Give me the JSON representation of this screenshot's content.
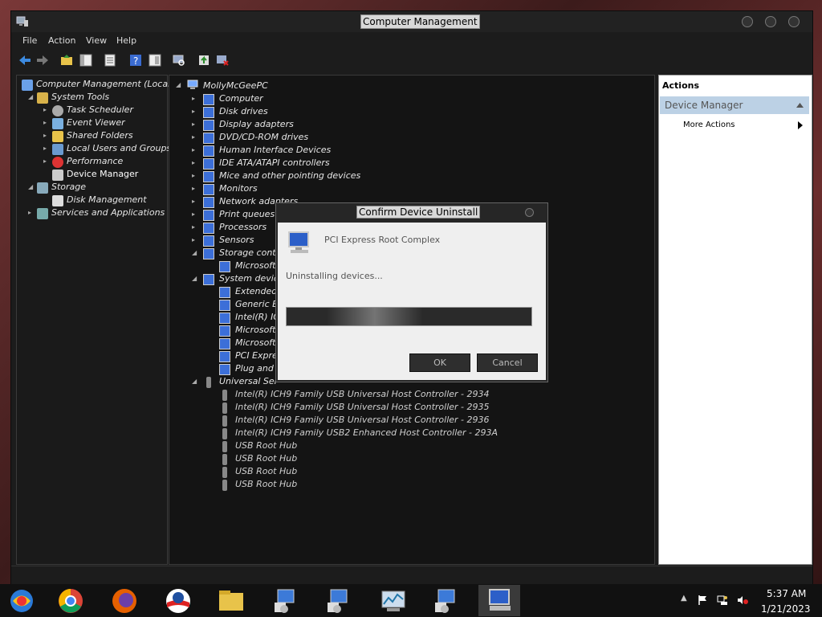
{
  "window": {
    "title": "Computer Management"
  },
  "menu": [
    "File",
    "Action",
    "View",
    "Help"
  ],
  "left_tree": [
    {
      "label": "Computer Management (Local)",
      "level": 0
    },
    {
      "label": "System Tools",
      "level": 1
    },
    {
      "label": "Task Scheduler",
      "level": 2
    },
    {
      "label": "Event Viewer",
      "level": 2
    },
    {
      "label": "Shared Folders",
      "level": 2
    },
    {
      "label": "Local Users and Groups",
      "level": 2
    },
    {
      "label": "Performance",
      "level": 2
    },
    {
      "label": "Device Manager",
      "level": 2
    },
    {
      "label": "Storage",
      "level": 1
    },
    {
      "label": "Disk Management",
      "level": 2
    },
    {
      "label": "Services and Applications",
      "level": 1
    }
  ],
  "device_tree": {
    "root": "MollyMcGeePC",
    "items": [
      {
        "label": "Computer",
        "level": 1
      },
      {
        "label": "Disk drives",
        "level": 1
      },
      {
        "label": "Display adapters",
        "level": 1
      },
      {
        "label": "DVD/CD-ROM drives",
        "level": 1
      },
      {
        "label": "Human Interface Devices",
        "level": 1
      },
      {
        "label": "IDE ATA/ATAPI controllers",
        "level": 1
      },
      {
        "label": "Mice and other pointing devices",
        "level": 1
      },
      {
        "label": "Monitors",
        "level": 1
      },
      {
        "label": "Network adapters",
        "level": 1
      },
      {
        "label": "Print queues",
        "level": 1
      },
      {
        "label": "Processors",
        "level": 1
      },
      {
        "label": "Sensors",
        "level": 1
      },
      {
        "label": "Storage contr",
        "level": 1
      },
      {
        "label": "Microsoft",
        "level": 2
      },
      {
        "label": "System device",
        "level": 1
      },
      {
        "label": "Extended",
        "level": 2
      },
      {
        "label": "Generic B",
        "level": 2
      },
      {
        "label": "Intel(R) IC",
        "level": 2
      },
      {
        "label": "Microsoft",
        "level": 2
      },
      {
        "label": "Microsoft",
        "level": 2
      },
      {
        "label": "PCI Expre",
        "level": 2
      },
      {
        "label": "Plug and",
        "level": 2
      },
      {
        "label": "Universal Ser",
        "level": 1
      },
      {
        "label": "Intel(R) ICH9 Family USB Universal Host Controller - 2934",
        "level": 2
      },
      {
        "label": "Intel(R) ICH9 Family USB Universal Host Controller - 2935",
        "level": 2
      },
      {
        "label": "Intel(R) ICH9 Family USB Universal Host Controller - 2936",
        "level": 2
      },
      {
        "label": "Intel(R) ICH9 Family USB2 Enhanced Host Controller - 293A",
        "level": 2
      },
      {
        "label": "USB Root Hub",
        "level": 2
      },
      {
        "label": "USB Root Hub",
        "level": 2
      },
      {
        "label": "USB Root Hub",
        "level": 2
      },
      {
        "label": "USB Root Hub",
        "level": 2
      }
    ]
  },
  "actions": {
    "title": "Actions",
    "section": "Device Manager",
    "more": "More Actions"
  },
  "dialog": {
    "title": "Confirm Device Uninstall",
    "device": "PCI Express Root Complex",
    "status": "Uninstalling devices...",
    "ok": "OK",
    "cancel": "Cancel"
  },
  "clock": {
    "time": "5:37 AM",
    "date": "1/21/2023"
  }
}
